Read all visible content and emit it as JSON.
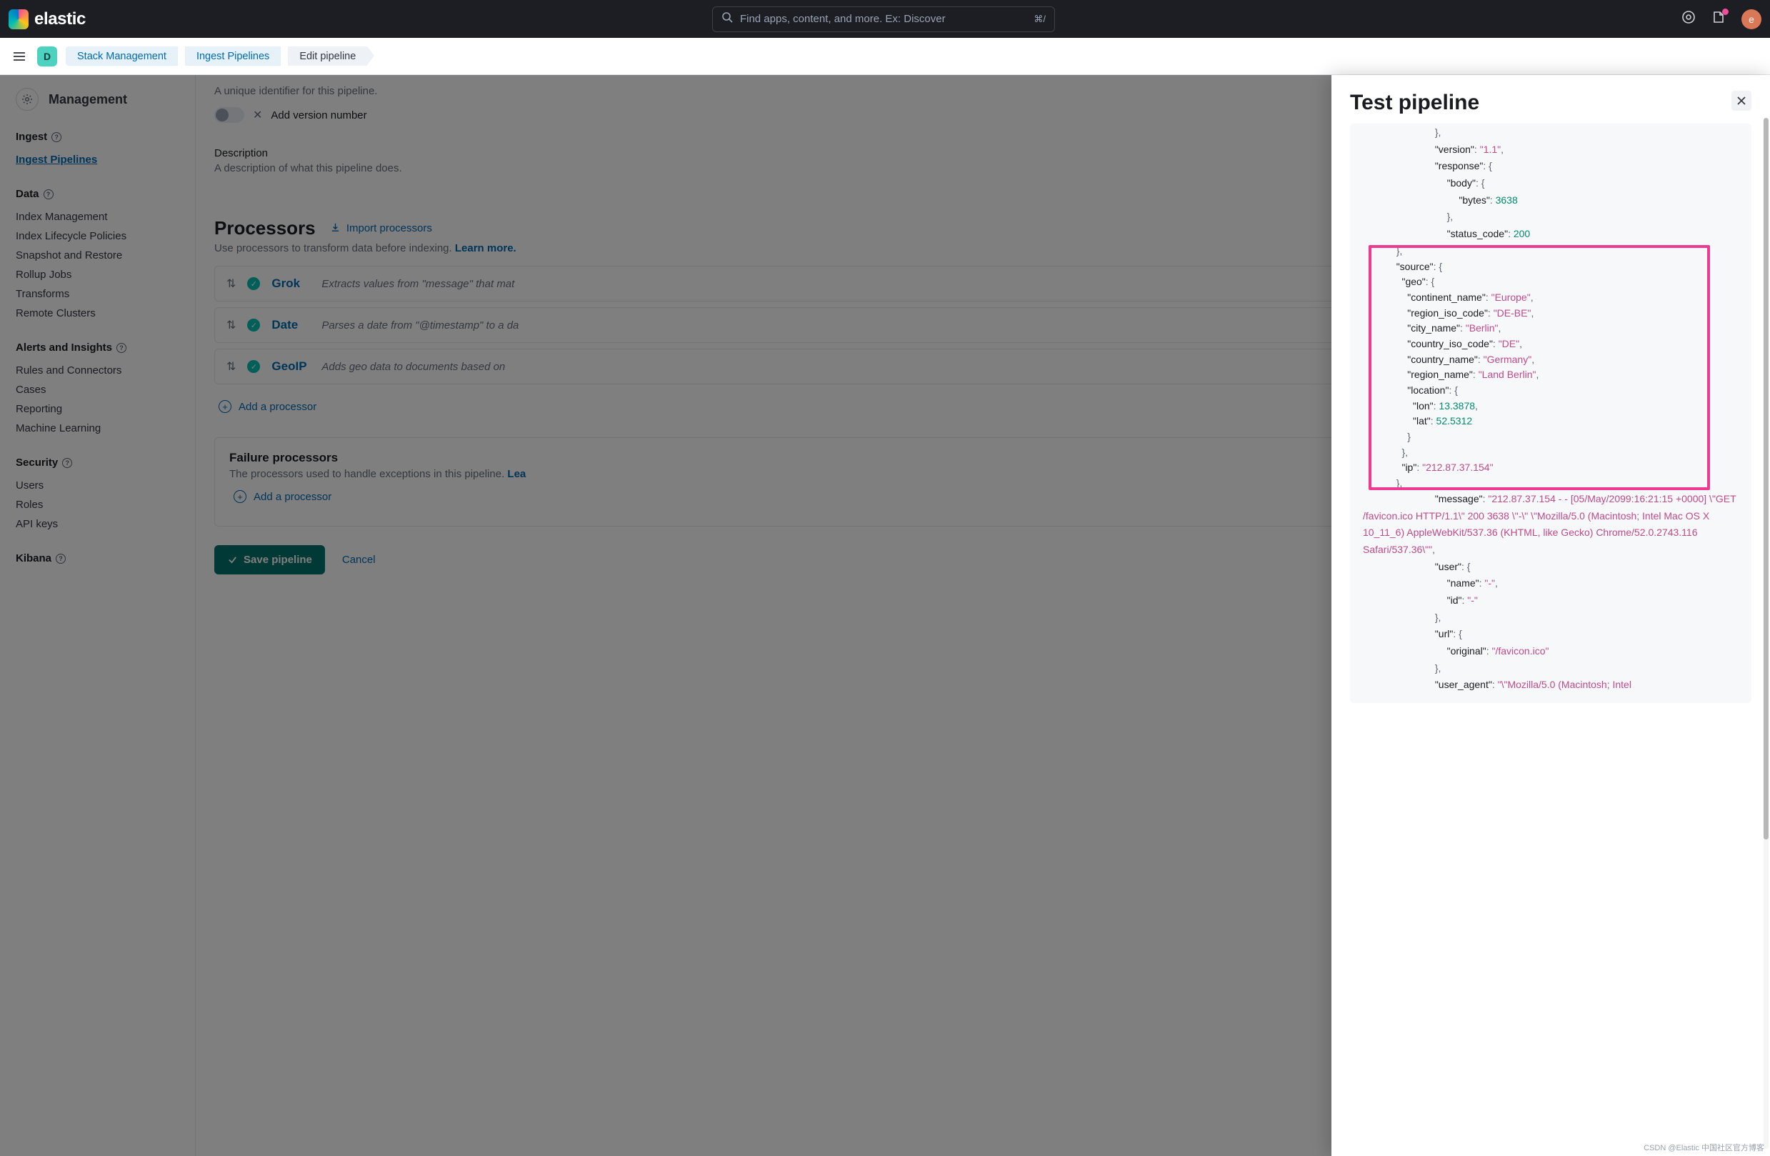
{
  "header": {
    "brand": "elastic",
    "search_placeholder": "Find apps, content, and more. Ex: Discover",
    "shortcut": "⌘/",
    "avatar_letter": "e"
  },
  "subheader": {
    "space_letter": "D",
    "breadcrumbs": [
      "Stack Management",
      "Ingest Pipelines",
      "Edit pipeline"
    ]
  },
  "sidebar": {
    "title": "Management",
    "groups": [
      {
        "title": "Ingest",
        "items": [
          "Ingest Pipelines"
        ],
        "active": "Ingest Pipelines"
      },
      {
        "title": "Data",
        "items": [
          "Index Management",
          "Index Lifecycle Policies",
          "Snapshot and Restore",
          "Rollup Jobs",
          "Transforms",
          "Remote Clusters"
        ]
      },
      {
        "title": "Alerts and Insights",
        "items": [
          "Rules and Connectors",
          "Cases",
          "Reporting",
          "Machine Learning"
        ]
      },
      {
        "title": "Security",
        "items": [
          "Users",
          "Roles",
          "API keys"
        ]
      },
      {
        "title": "Kibana",
        "items": []
      }
    ]
  },
  "content": {
    "id_hint": "A unique identifier for this pipeline.",
    "version_label": "Add version number",
    "desc_title": "Description",
    "desc_hint": "A description of what this pipeline does.",
    "processors_title": "Processors",
    "import_label": "Import processors",
    "processors_hint": "Use processors to transform data before indexing.",
    "learn_more": "Learn more.",
    "processors": [
      {
        "name": "Grok",
        "desc": "Extracts values from \"message\" that mat"
      },
      {
        "name": "Date",
        "desc": "Parses a date from \"@timestamp\" to a da"
      },
      {
        "name": "GeoIP",
        "desc": "Adds geo data to documents based on"
      }
    ],
    "add_processor": "Add a processor",
    "failure_title": "Failure processors",
    "failure_hint_prefix": "The processors used to handle exceptions in this pipeline. ",
    "failure_learn": "Lea",
    "save_label": "Save pipeline",
    "cancel_label": "Cancel"
  },
  "flyout": {
    "title": "Test pipeline",
    "json_output": {
      "version": "1.1",
      "response": {
        "body": {
          "bytes": 3638
        },
        "status_code": 200
      },
      "source": {
        "geo": {
          "continent_name": "Europe",
          "region_iso_code": "DE-BE",
          "city_name": "Berlin",
          "country_iso_code": "DE",
          "country_name": "Germany",
          "region_name": "Land Berlin",
          "location": {
            "lon": 13.3878,
            "lat": 52.5312
          }
        },
        "ip": "212.87.37.154"
      },
      "message": "212.87.37.154 - - [05/May/2099:16:21:15 +0000] \\\"GET /favicon.ico HTTP/1.1\\\" 200 3638 \\\"-\\\" \\\"Mozilla/5.0 (Macintosh; Intel Mac OS X 10_11_6) AppleWebKit/537.36 (KHTML, like Gecko) Chrome/52.0.2743.116 Safari/537.36\\\"",
      "user": {
        "name": "-",
        "id": "-"
      },
      "url": {
        "original": "/favicon.ico"
      },
      "user_agent_partial": "\\\"Mozilla/5.0 (Macintosh; Intel"
    }
  },
  "watermark": "CSDN @Elastic 中国社区官方博客"
}
